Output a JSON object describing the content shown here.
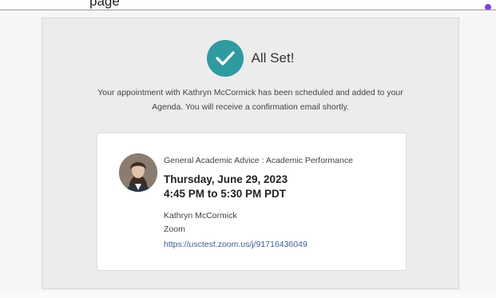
{
  "top_strip": {
    "partial_text": "page"
  },
  "header": {
    "title": "All Set!",
    "icon": "checkmark-icon",
    "icon_color": "#2f9aa0"
  },
  "message": {
    "line1": "Your appointment with Kathryn McCormick has been scheduled and added to your",
    "line2": "Agenda. You will receive a confirmation email shortly."
  },
  "appointment": {
    "type": "General Academic Advice : Academic Performance",
    "date": "Thursday, June 29, 2023",
    "time": "4:45 PM to 5:30 PM PDT",
    "advisor": "Kathryn McCormick",
    "location": "Zoom",
    "link": "https://usctest.zoom.us/j/91716436049"
  },
  "colors": {
    "accent": "#2f9aa0",
    "link": "#3d5f94",
    "top_accent": "#7b3fe4"
  }
}
